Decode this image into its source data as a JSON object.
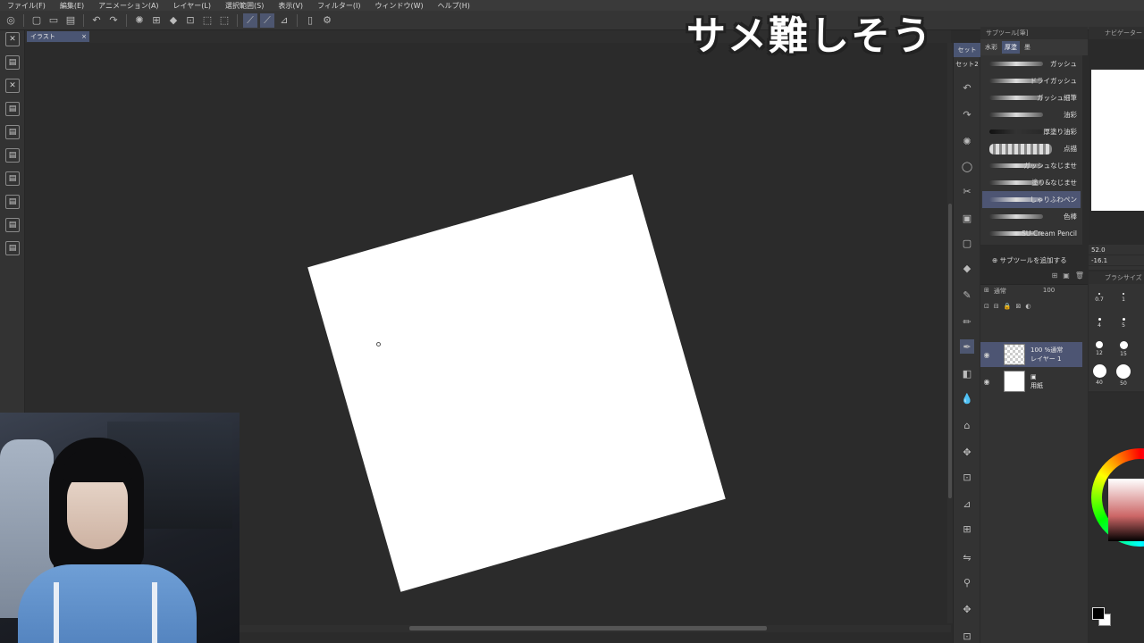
{
  "menu": [
    "ファイル(F)",
    "編集(E)",
    "アニメーション(A)",
    "レイヤー(L)",
    "選択範囲(S)",
    "表示(V)",
    "フィルター(I)",
    "ウィンドウ(W)",
    "ヘルプ(H)"
  ],
  "document_tab": {
    "label": "イラスト",
    "close": "×"
  },
  "caption": "サメ難しそう",
  "right_sets": [
    "セット",
    "セット2"
  ],
  "subtool": {
    "title": "サブツール[筆]",
    "tabs": [
      "水彩",
      "厚塗",
      "墨"
    ],
    "brushes": [
      "ガッシュ",
      "ドライガッシュ",
      "ガッシュ細筆",
      "油彩",
      "厚塗り油彩",
      "点描",
      "ガッシュなじませ",
      "塗り&なじませ",
      "しゃりふわペン",
      "色棒",
      "SU-Cream Pencil"
    ],
    "active_brush_index": 8,
    "add_label": "サブツールを追加する"
  },
  "layers": {
    "blend_mode": "通常",
    "opacity": "100",
    "items": [
      {
        "meta": "100 %通常",
        "name": "レイヤー 1",
        "active": true
      },
      {
        "meta": "",
        "name": "用紙",
        "active": false
      }
    ]
  },
  "navigator": {
    "title": "ナビゲーター",
    "zoom": "52.0",
    "rotation": "-16.1"
  },
  "brush_size": {
    "title": "ブラシサイズ",
    "sizes": [
      "0.7",
      "1",
      "4",
      "5",
      "12",
      "15",
      "40",
      "50"
    ]
  },
  "colors": {
    "panel_bg": "#333333",
    "canvas_bg": "#2b2b2b",
    "accent": "#4d5573",
    "paper": "#ffffff",
    "main_color": "#000000",
    "sub_color": "#ffffff"
  }
}
